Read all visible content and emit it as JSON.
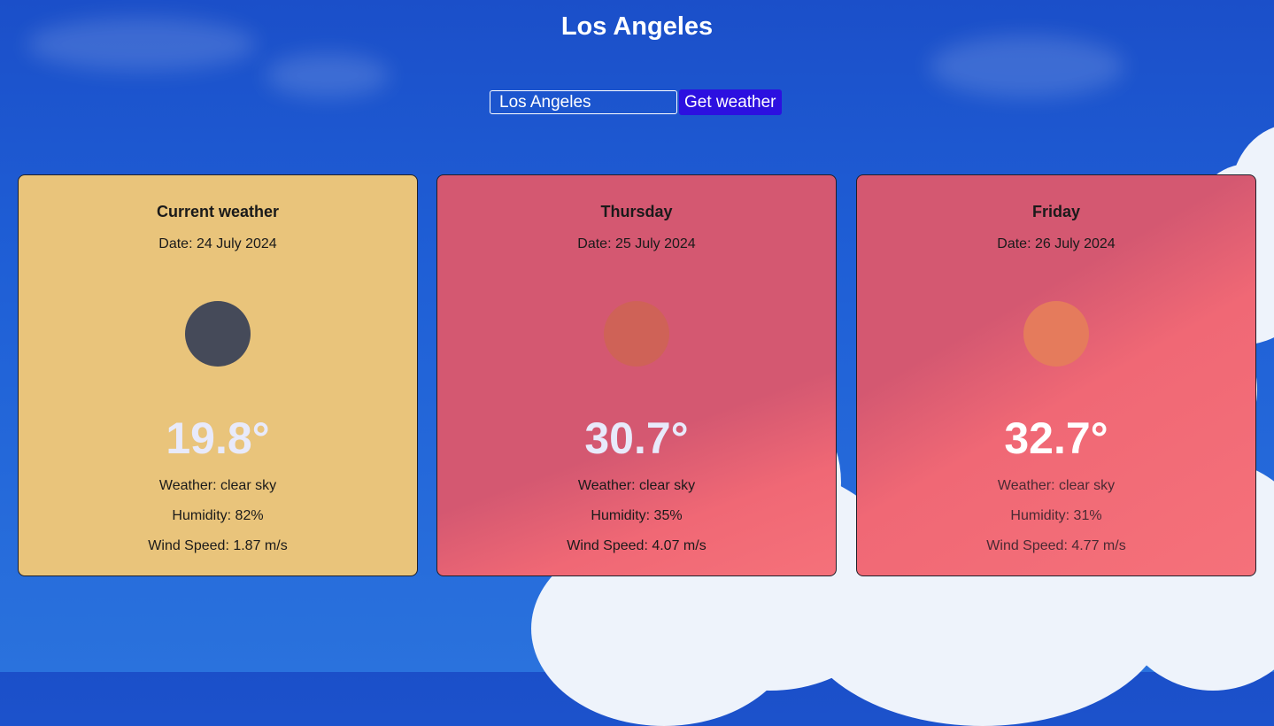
{
  "city_title": "Los Angeles",
  "search": {
    "value": "Los Angeles",
    "button_label": "Get weather"
  },
  "colors": {
    "current_card": "#e9c47b",
    "forecast_card": "#d45871",
    "button": "#2c10e0",
    "temp_text": "#e8eafb"
  },
  "cards": [
    {
      "heading": "Current weather",
      "date": "Date: 24 July 2024",
      "icon": "sun-icon",
      "temp": "19.8°",
      "weather": "Weather: clear sky",
      "humidity": "Humidity: 82%",
      "wind": "Wind Speed: 1.87 m/s"
    },
    {
      "heading": "Thursday",
      "date": "Date: 25 July 2024",
      "icon": "sun-icon",
      "temp": "30.7°",
      "weather": "Weather: clear sky",
      "humidity": "Humidity: 35%",
      "wind": "Wind Speed: 4.07 m/s"
    },
    {
      "heading": "Friday",
      "date": "Date: 26 July 2024",
      "icon": "sun-icon",
      "temp": "32.7°",
      "weather": "Weather: clear sky",
      "humidity": "Humidity: 31%",
      "wind": "Wind Speed: 4.77 m/s"
    }
  ]
}
